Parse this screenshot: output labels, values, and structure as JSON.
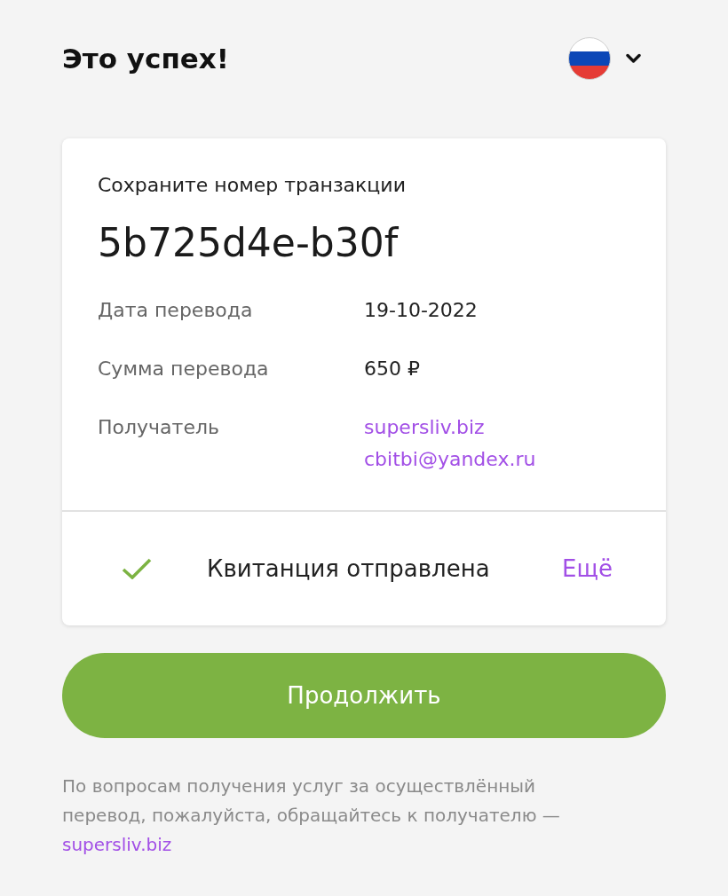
{
  "header": {
    "title": "Это успех!"
  },
  "card": {
    "caption": "Сохраните номер транзакции",
    "transaction_id": "5b725d4e-b30f",
    "details": [
      {
        "label": "Дата перевода",
        "kind": "text",
        "values": [
          "19-10-2022"
        ]
      },
      {
        "label": "Сумма перевода",
        "kind": "text",
        "values": [
          "650 ₽"
        ]
      },
      {
        "label": "Получатель",
        "kind": "link",
        "values": [
          "supersliv.biz",
          "cbitbi@yandex.ru"
        ]
      }
    ],
    "receipt": {
      "sent": true,
      "status": "Квитанция отправлена",
      "more": "Ещё"
    }
  },
  "button": {
    "label": "Продолжить"
  },
  "footer": {
    "text": "По вопросам получения услуг за осуществлённый перевод, пожалуйста, обращайтесь к получателю —",
    "link": "supersliv.biz"
  }
}
